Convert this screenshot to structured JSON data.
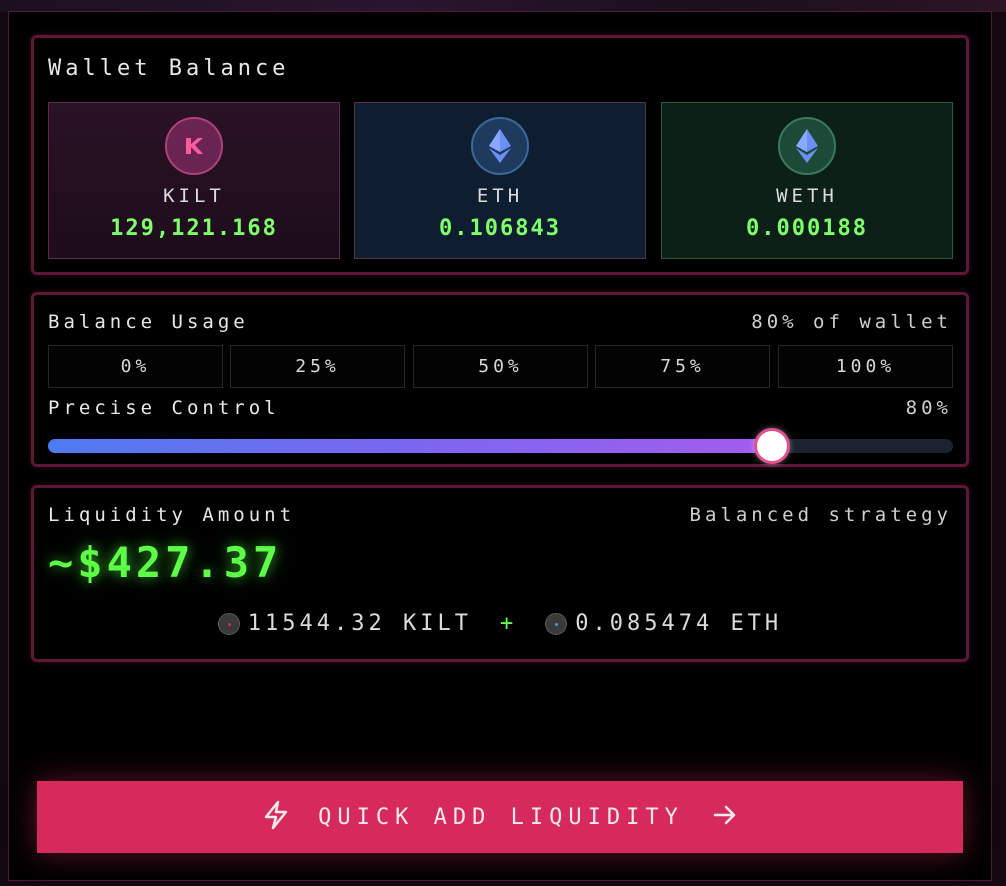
{
  "wallet": {
    "title": "Wallet Balance",
    "tokens": [
      {
        "symbol": "KILT",
        "balance": "129,121.168",
        "icon": "kilt-icon"
      },
      {
        "symbol": "ETH",
        "balance": "0.106843",
        "icon": "eth-icon"
      },
      {
        "symbol": "WETH",
        "balance": "0.000188",
        "icon": "weth-icon"
      }
    ]
  },
  "usage": {
    "title": "Balance Usage",
    "summary": "80% of wallet",
    "options": [
      "0%",
      "25%",
      "50%",
      "75%",
      "100%"
    ],
    "precise_label": "Precise Control",
    "precise_value": "80%",
    "slider_fraction": 0.8
  },
  "liquidity": {
    "title": "Liquidity Amount",
    "strategy": "Balanced strategy",
    "amount": "~$427.37",
    "kilt_part": "11544.32 KILT",
    "plus": "+",
    "eth_part": "0.085474 ETH"
  },
  "cta": {
    "label": "QUICK ADD LIQUIDITY",
    "left_icon": "lightning-icon",
    "right_icon": "arrow-right-icon"
  },
  "colors": {
    "accent": "#d62a5c",
    "balance_green": "#7dff6a",
    "amount_green": "#5cff46"
  }
}
